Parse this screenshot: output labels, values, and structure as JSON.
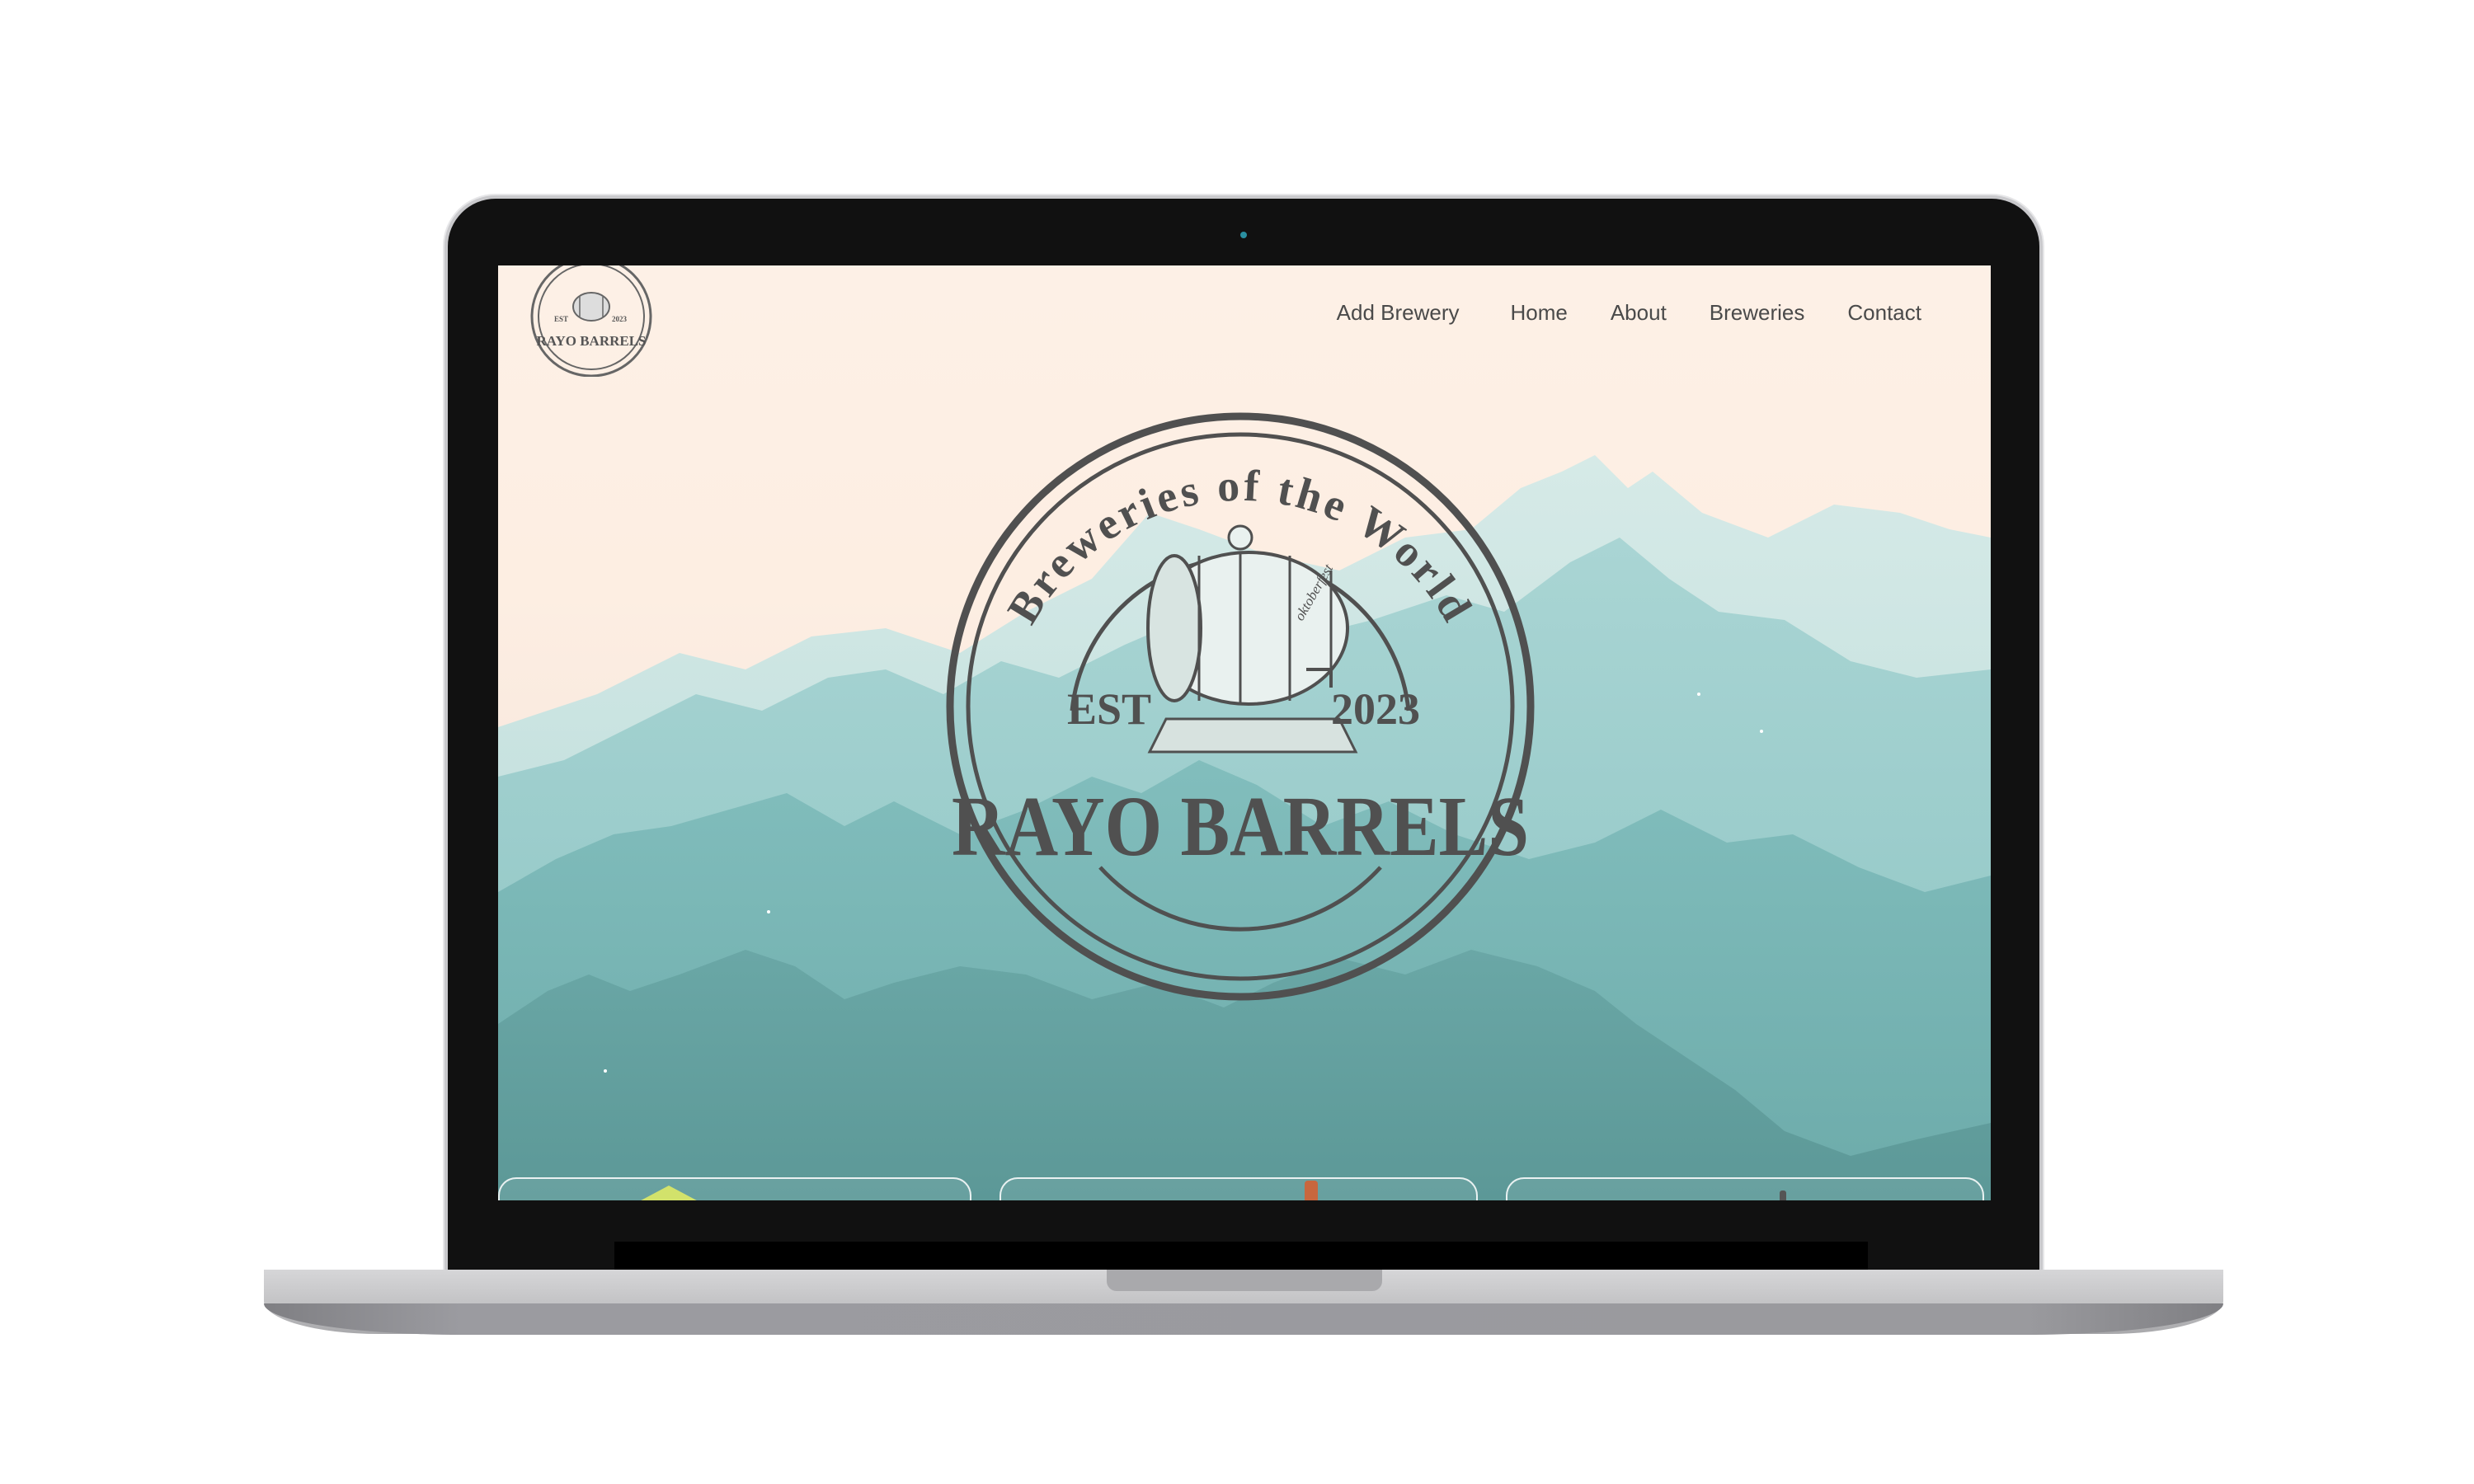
{
  "site": {
    "brand": "RAYO BARRELS",
    "tagline": "Breweries of the World",
    "est_label": "EST",
    "est_year": "2023",
    "barrel_label": "oktoberfest"
  },
  "nav": {
    "items": [
      {
        "label": "Add Brewery"
      },
      {
        "label": "Home"
      },
      {
        "label": "About"
      },
      {
        "label": "Breweries"
      },
      {
        "label": "Contact"
      }
    ]
  },
  "colors": {
    "sky": "#fdf0e6",
    "mountain_light": "#b7dcdd",
    "mountain_mid": "#84c2c1",
    "mountain_dark": "#5f9e9d",
    "logo_ink": "#505050"
  }
}
